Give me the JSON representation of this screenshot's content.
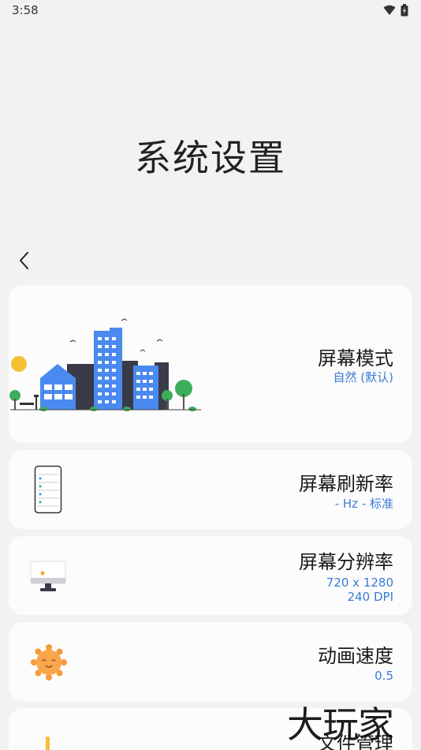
{
  "status_bar": {
    "time": "3:58"
  },
  "page": {
    "title": "系统设置"
  },
  "settings": [
    {
      "title": "屏幕模式",
      "subtitle": "自然 (默认)"
    },
    {
      "title": "屏幕刷新率",
      "subtitle": "- Hz - 标准"
    },
    {
      "title": "屏幕分辨率",
      "subtitle_line1": "720 x 1280",
      "subtitle_line2": "240 DPI"
    },
    {
      "title": "动画速度",
      "subtitle": "0.5"
    },
    {
      "title": "文件管理"
    }
  ],
  "watermark": "大玩家",
  "colors": {
    "accent": "#3a7bd5",
    "card_bg": "#fcfcfc",
    "page_bg": "#f2f2f2"
  }
}
